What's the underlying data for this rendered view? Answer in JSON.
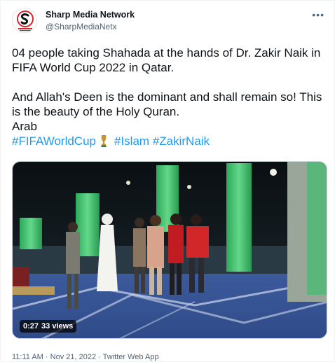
{
  "author": {
    "name": "Sharp Media Network",
    "handle": "@SharpMediaNetx"
  },
  "icons": {
    "more": "more-icon",
    "avatar": "sharp-media-logo",
    "trophy": "trophy-icon"
  },
  "tweet": {
    "line1": "04 people taking Shahada at the hands of Dr. Zakir Naik in FIFA World Cup 2022 in Qatar.",
    "line2": "And Allah's Deen is the dominant and shall remain so! This is the beauty of the Holy Quran.",
    "line3": "Arab",
    "hashtags": [
      "#FIFAWorldCup",
      "#Islam",
      "#ZakirNaik"
    ]
  },
  "media": {
    "duration": "0:27",
    "views": "33 views"
  },
  "meta": {
    "time": "11:11 AM",
    "date": "Nov 21, 2022",
    "separator": "·",
    "source": "Twitter Web App"
  },
  "colors": {
    "link": "#1d9bf0",
    "secondary": "#536471",
    "brand_red": "#d7262b"
  }
}
